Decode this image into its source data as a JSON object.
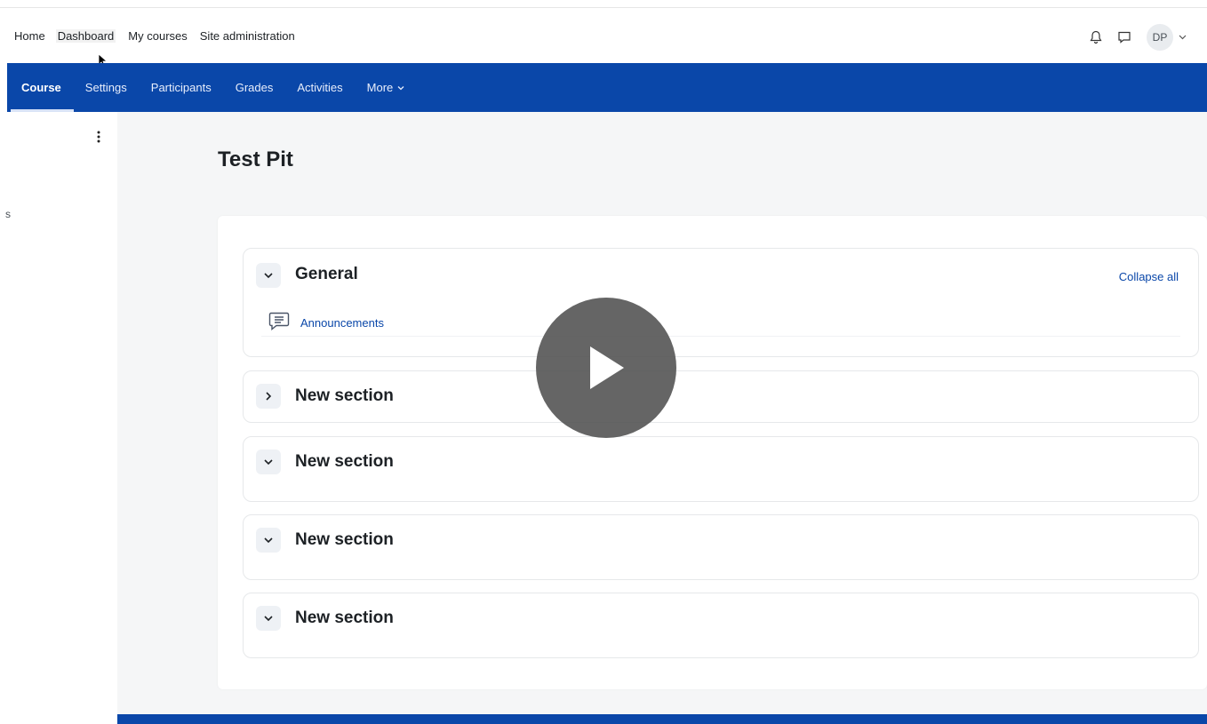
{
  "top_nav": {
    "items": [
      "Home",
      "Dashboard",
      "My courses",
      "Site administration"
    ],
    "avatar_initials": "DP",
    "icons": [
      "bell-icon",
      "message-icon",
      "chevron-down-icon"
    ]
  },
  "secondary_nav": {
    "tabs": [
      "Course",
      "Settings",
      "Participants",
      "Grades",
      "Activities",
      "More"
    ],
    "active_tab": "Course"
  },
  "sidebar": {
    "stray_text": "s"
  },
  "course": {
    "title": "Test Pit",
    "collapse_all_label": "Collapse all",
    "sections": [
      {
        "title": "General",
        "state": "expanded",
        "activities": [
          {
            "label": "Announcements",
            "icon": "forum-icon"
          }
        ]
      },
      {
        "title": "New section",
        "state": "collapsed"
      },
      {
        "title": "New section",
        "state": "expanded"
      },
      {
        "title": "New section",
        "state": "expanded"
      },
      {
        "title": "New section",
        "state": "expanded"
      }
    ]
  },
  "colors": {
    "brand_blue": "#0a47a9",
    "link_blue": "#0a47a9",
    "overlay": "#505050"
  },
  "overlay": {
    "icon": "play-icon"
  }
}
